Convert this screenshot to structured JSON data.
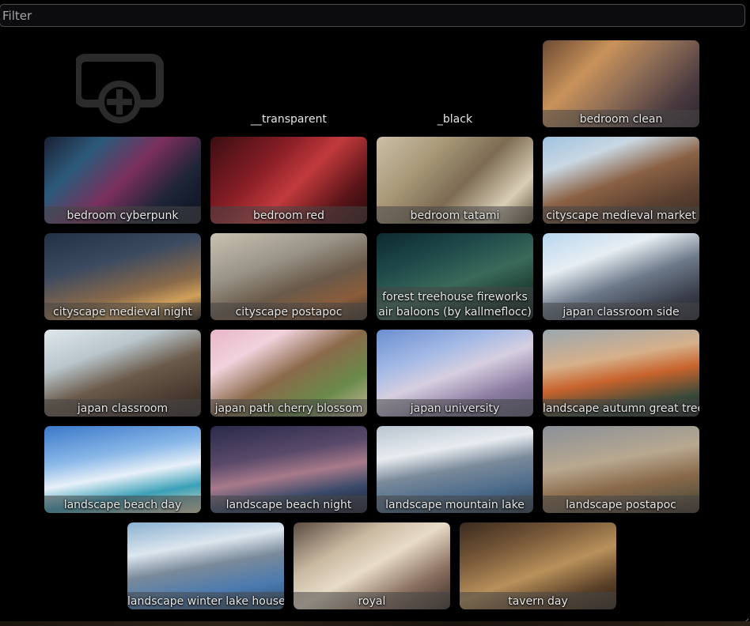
{
  "filter": {
    "placeholder": "Filter",
    "value": ""
  },
  "add_item": {
    "icon": "add-icon",
    "label": ""
  },
  "cards": [
    {
      "label": "__transparent",
      "bg": "transparent"
    },
    {
      "label": "_black",
      "bg": "#000000"
    },
    {
      "label": "bedroom clean",
      "bg": "linear-gradient(135deg,#6b4a33 0%,#c9925a 30%,#8a6a55 55%,#4a3a40 80%,#2d2330 100%)"
    },
    {
      "label": "bedroom cyberpunk",
      "bg": "linear-gradient(135deg,#1b2033 0%,#2c5a7a 25%,#7a2f5c 50%,#1c2436 75%,#0d1222 100%)"
    },
    {
      "label": "bedroom red",
      "bg": "linear-gradient(135deg,#3a0e12 0%,#8a1e26 35%,#c23a3c 55%,#5a1418 80%,#2a0a0c 100%)"
    },
    {
      "label": "bedroom tatami",
      "bg": "linear-gradient(135deg,#cbbfa6 0%,#a89878 30%,#7c6b52 55%,#d9ceb6 80%,#5e4e3a 100%)"
    },
    {
      "label": "cityscape medieval market",
      "bg": "linear-gradient(160deg,#9fc3e0 0%,#c9d7e2 25%,#8a6144 50%,#5b4030 75%,#3a2a20 100%)"
    },
    {
      "label": "cityscape medieval night",
      "bg": "linear-gradient(165deg,#223145 0%,#3c4a60 35%,#8a6a4a 65%,#d1a05a 80%,#2a2016 100%)"
    },
    {
      "label": "cityscape postapoc",
      "bg": "linear-gradient(160deg,#c9c2b2 0%,#9a9488 35%,#6a5a4a 60%,#8a5c3a 80%,#3a322a 100%)"
    },
    {
      "label": "forest treehouse fireworks air baloons (by kallmeflocc)",
      "bg": "linear-gradient(160deg,#0d2a2e 0%,#1f4a4a 30%,#3a6a5a 55%,#1a3a30 80%,#0a1a18 100%)"
    },
    {
      "label": "japan classroom side",
      "bg": "linear-gradient(160deg,#b8d6ef 0%,#e7eef3 30%,#6d7a8a 55%,#3a3e4a 80%,#22252e 100%)"
    },
    {
      "label": "japan classroom",
      "bg": "linear-gradient(160deg,#dfe7ec 0%,#b9c6cc 30%,#6a5a4a 55%,#4a3a30 80%,#2a2420 100%)"
    },
    {
      "label": "japan path cherry blossom",
      "bg": "linear-gradient(150deg,#e8b5c8 0%,#f1d2dc 25%,#8a6a4a 50%,#6a8a4a 75%,#c8b89a 100%)"
    },
    {
      "label": "japan university",
      "bg": "linear-gradient(160deg,#6a8ed0 0%,#a3b9e5 30%,#d6cfe0 50%,#8a7aa0 75%,#5a5a70 100%)"
    },
    {
      "label": "landscape autumn great tree",
      "bg": "linear-gradient(170deg,#9aa7b0 0%,#d6b08a 35%,#c8632c 55%,#3a4a3a 80%,#1a2420 100%)"
    },
    {
      "label": "landscape beach day",
      "bg": "linear-gradient(170deg,#3a78c8 0%,#8ab8e8 35%,#e8f0f8 55%,#3aa0b8 75%,#e6d8b8 100%)"
    },
    {
      "label": "landscape beach night",
      "bg": "linear-gradient(170deg,#2a2a4a 0%,#5a4a6a 35%,#a87a8a 55%,#3a4a6a 75%,#1a1a2a 100%)"
    },
    {
      "label": "landscape mountain lake",
      "bg": "linear-gradient(170deg,#b8c4d0 0%,#e8ecf0 30%,#7a8a9a 50%,#4a6a8a 75%,#2a3a4a 100%)"
    },
    {
      "label": "landscape postapoc",
      "bg": "linear-gradient(170deg,#8a9098 0%,#b8a890 40%,#8a6a4a 65%,#6a5a44 80%,#3a3024 100%)"
    },
    {
      "label": "landscape winter lake house",
      "bg": "linear-gradient(170deg,#8ab0d0 0%,#dce6ee 30%,#7a8a9a 50%,#4a7ab0 75%,#2a4a6a 100%)"
    },
    {
      "label": "royal",
      "bg": "linear-gradient(150deg,#5a4a40 0%,#c8b8a0 30%,#e8dcc8 50%,#8a7060 75%,#3a2e28 100%)"
    },
    {
      "label": "tavern day",
      "bg": "linear-gradient(160deg,#3a2a1e 0%,#7a5a3a 30%,#b8905a 55%,#5a4028 80%,#2a1e14 100%)"
    }
  ]
}
